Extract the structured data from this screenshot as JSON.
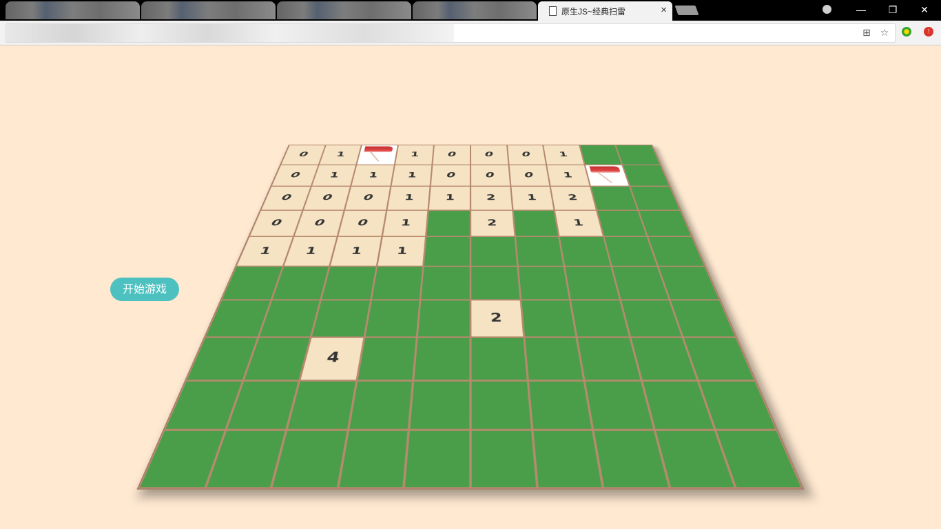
{
  "browser": {
    "tab_title": "原生JS~经典扫雷",
    "tab_close": "×",
    "window_controls": {
      "minimize": "—",
      "restore": "❐",
      "close": "✕"
    }
  },
  "page": {
    "start_button_label": "开始游戏"
  },
  "board": {
    "rows": 10,
    "cols": 10,
    "cells": [
      [
        "0",
        "1",
        "F",
        "1",
        "0",
        "0",
        "0",
        "1",
        "",
        ""
      ],
      [
        "0",
        "1",
        "1",
        "1",
        "0",
        "0",
        "0",
        "1",
        "F",
        ""
      ],
      [
        "0",
        "0",
        "0",
        "1",
        "1",
        "2",
        "1",
        "2",
        "",
        ""
      ],
      [
        "0",
        "0",
        "0",
        "1",
        "",
        "2",
        "",
        "1",
        "",
        ""
      ],
      [
        "1",
        "1",
        "1",
        "1",
        "",
        "",
        "",
        "",
        "",
        ""
      ],
      [
        "",
        "",
        "",
        "",
        "",
        "",
        "",
        "",
        "",
        ""
      ],
      [
        "",
        "",
        "",
        "",
        "",
        "2",
        "",
        "",
        "",
        ""
      ],
      [
        "",
        "",
        "4",
        "",
        "",
        "",
        "",
        "",
        "",
        ""
      ],
      [
        "",
        "",
        "",
        "",
        "",
        "",
        "",
        "",
        "",
        ""
      ],
      [
        "",
        "",
        "",
        "",
        "",
        "",
        "",
        "",
        "",
        ""
      ]
    ],
    "legend": {
      "empty_string": "closed cell",
      "F": "flag",
      "digit": "revealed number"
    },
    "colors": {
      "closed": "#4a9e4a",
      "open": "#f5e3c3",
      "grid_line": "#b78a6e",
      "background": "#ffe9d1",
      "button": "#4cc1bf"
    }
  }
}
